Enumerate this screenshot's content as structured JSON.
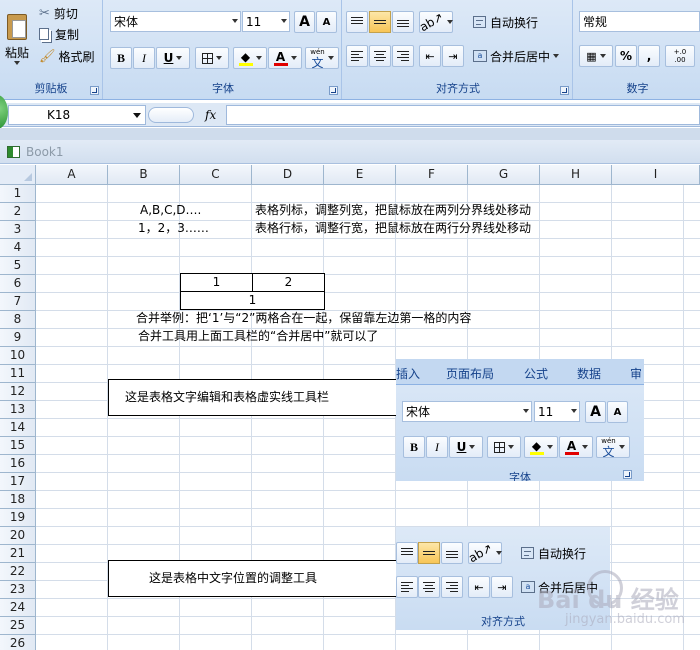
{
  "ribbon": {
    "clipboard": {
      "paste": "粘贴",
      "cut": "剪切",
      "copy": "复制",
      "format_painter": "格式刷",
      "label": "剪贴板"
    },
    "font": {
      "name": "宋体",
      "size": "11",
      "bold": "B",
      "italic": "I",
      "underline": "U",
      "label": "字体",
      "font_color": "A",
      "grow": "A",
      "shrink": "A",
      "phonetic": "wén",
      "phonetic_char": "文"
    },
    "alignment": {
      "wrap": "自动换行",
      "merge": "合并后居中",
      "label": "对齐方式"
    },
    "number": {
      "format": "常规",
      "percent": "%",
      "comma": ",",
      "increase_decimal": "+.0 .00",
      "label": "数字"
    }
  },
  "formula_bar": {
    "name_box": "K18",
    "fx": "fx"
  },
  "workbook": {
    "title": "Book1"
  },
  "sheet": {
    "columns": [
      "A",
      "B",
      "C",
      "D",
      "E",
      "F",
      "G",
      "H",
      "I"
    ],
    "rows": [
      "1",
      "2",
      "3",
      "4",
      "5",
      "6",
      "7",
      "8",
      "9",
      "10",
      "11",
      "12",
      "13",
      "14",
      "15",
      "16",
      "17",
      "18",
      "19",
      "20",
      "21",
      "22",
      "23",
      "24",
      "25",
      "26"
    ],
    "cells": {
      "b2": "A,B,C,D….",
      "d2": "表格列标，调整列宽，把鼠标放在两列分界线处移动",
      "b3": "1，2，3……",
      "d3": "表格行标，调整行宽，把鼠标放在两行分界线处移动",
      "c6": "1",
      "d6": "2",
      "c7": "1",
      "b8": "合并举例：把‘1’与“2”两格合在一起，保留靠左边第一格的内容",
      "b9": "合并工具用上面工具栏的“合并居中”就可以了",
      "box1": "这是表格文字编辑和表格虚实线工具栏",
      "box2": "这是表格中文字位置的调整工具"
    }
  },
  "overlay_font": {
    "tabs": [
      "插入",
      "页面布局",
      "公式",
      "数据",
      "审"
    ],
    "font_name": "宋体",
    "font_size": "11",
    "label": "字体"
  },
  "overlay_align": {
    "wrap": "自动换行",
    "merge": "合并后居中",
    "label": "对齐方式"
  },
  "watermark": {
    "text": "Bai du 经验",
    "sub": "jingyan.baidu.com"
  }
}
